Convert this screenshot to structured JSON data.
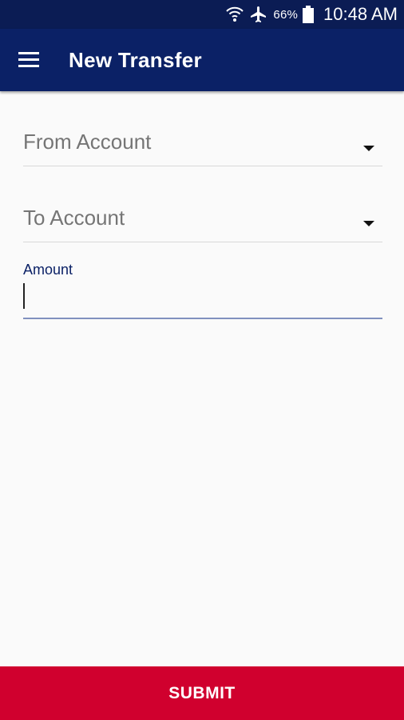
{
  "status_bar": {
    "battery": "66%",
    "time": "10:48 AM",
    "icons": [
      "wifi-icon",
      "airplane-mode-icon",
      "battery-icon"
    ]
  },
  "app_bar": {
    "title": "New Transfer",
    "menu_icon": "hamburger-menu-icon",
    "color": "#0b2166"
  },
  "form": {
    "from_account": {
      "placeholder": "From Account",
      "icon": "dropdown-arrow-icon"
    },
    "to_account": {
      "placeholder": "To Account",
      "icon": "dropdown-arrow-icon"
    },
    "amount": {
      "label": "Amount",
      "value": ""
    }
  },
  "submit": {
    "label": "SUBMIT",
    "color": "#d0002e"
  }
}
